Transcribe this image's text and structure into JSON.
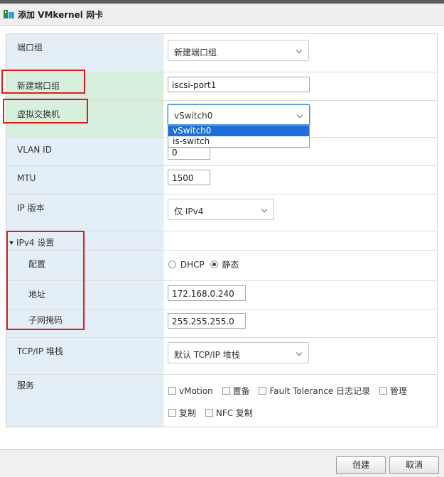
{
  "dialog": {
    "title": "添加 VMkernel 网卡"
  },
  "form": {
    "port_group": {
      "label": "端口组",
      "value": "新建端口组"
    },
    "new_port_group": {
      "label": "新建端口组",
      "value": "iscsi-port1"
    },
    "vswitch": {
      "label": "虚拟交换机",
      "value": "vSwitch0",
      "options": [
        "vSwitch0",
        "is-switch"
      ]
    },
    "vlan_id": {
      "label": "VLAN ID",
      "value": "0"
    },
    "mtu": {
      "label": "MTU",
      "value": "1500"
    },
    "ip_version": {
      "label": "IP 版本",
      "value": "仅 IPv4"
    },
    "ipv4": {
      "section_label": "IPv4 设置",
      "config": {
        "label": "配置",
        "dhcp": "DHCP",
        "static": "静态",
        "selected": "静态"
      },
      "address": {
        "label": "地址",
        "value": "172.168.0.240"
      },
      "subnet": {
        "label": "子网掩码",
        "value": "255.255.255.0"
      }
    },
    "tcpip_stack": {
      "label": "TCP/IP 堆栈",
      "value": "默认 TCP/IP 堆栈"
    },
    "services": {
      "label": "服务",
      "items": [
        "vMotion",
        "置备",
        "Fault Tolerance 日志记录",
        "管理",
        "复制",
        "NFC 复制"
      ]
    }
  },
  "footer": {
    "create_label": "创建",
    "cancel_label": "取消"
  },
  "colors": {
    "highlight": "#e21b1b",
    "selected": "#1e6fd9",
    "label_bg": "#e4eef6",
    "label_bg_active": "#d6f0dd"
  }
}
